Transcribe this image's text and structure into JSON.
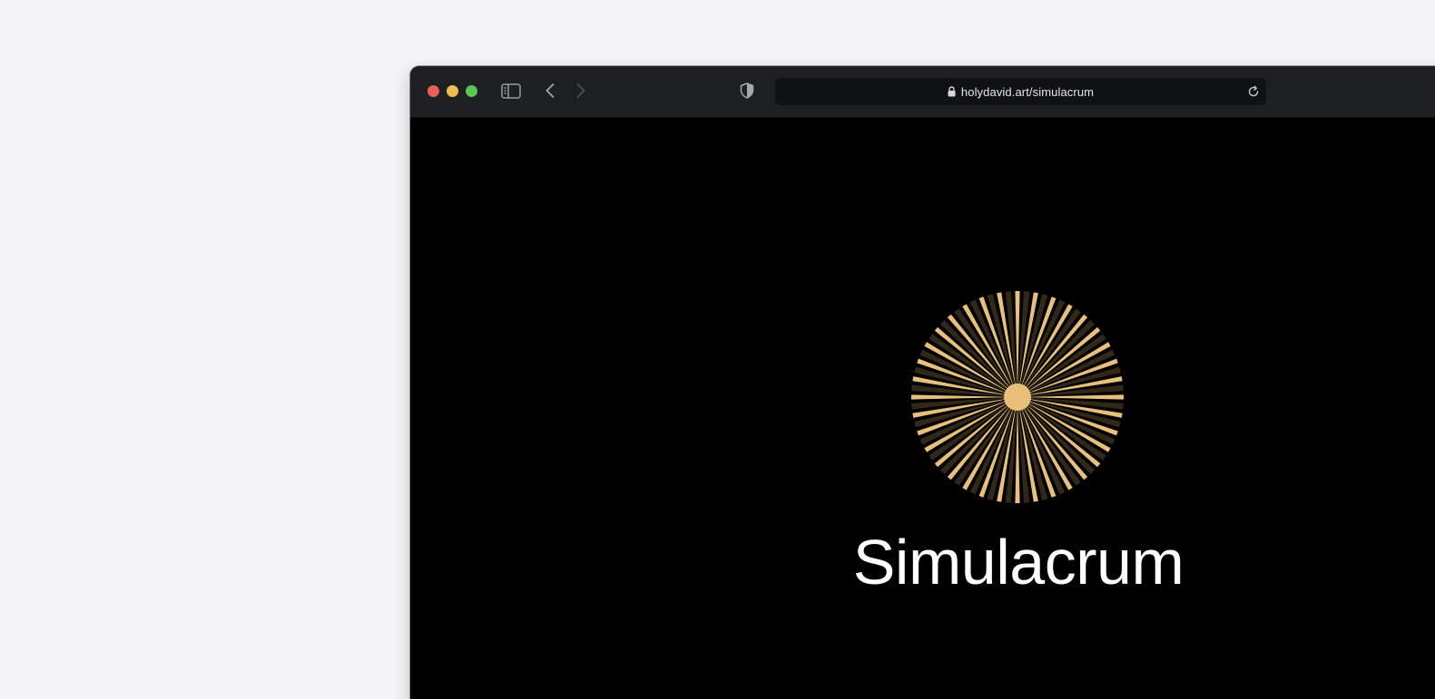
{
  "browser": {
    "address_bar": {
      "url": "holydavid.art/simulacrum",
      "icons": {
        "lock": "lock-icon",
        "reload": "reload-icon"
      }
    },
    "toolbar_icons": {
      "sidebar": "sidebar-icon",
      "back": "chevron-left-icon",
      "forward": "chevron-right-icon",
      "privacy": "shield-icon"
    },
    "traffic_light_colors": {
      "close": "#ec5f57",
      "minimize": "#f1bd4f",
      "zoom": "#5ac653"
    }
  },
  "page": {
    "title": "Simulacrum",
    "logo": {
      "icon": "sunburst-icon",
      "ray_color": "#e8c07a",
      "dim_ray_color": "#3a2f1e"
    },
    "background_color": "#000000"
  }
}
